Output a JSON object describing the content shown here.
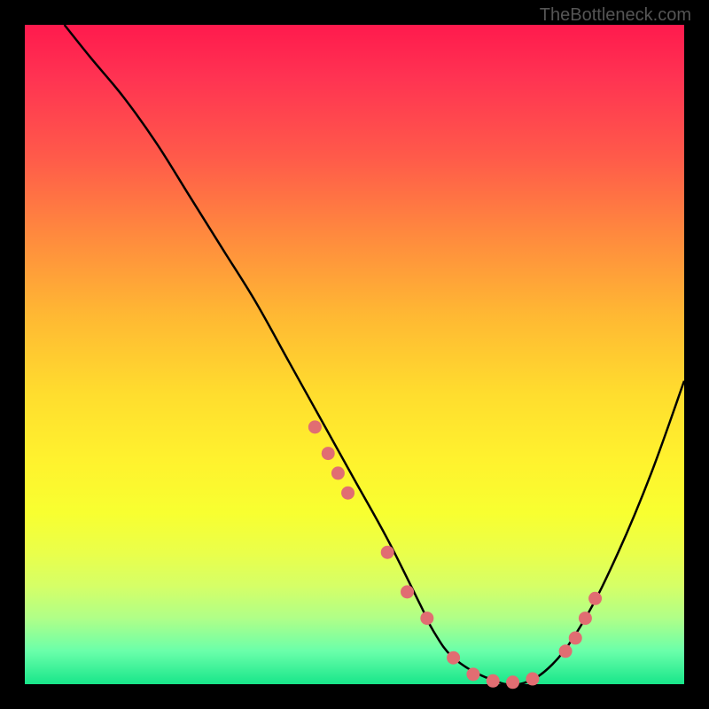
{
  "watermark": "TheBottleneck.com",
  "chart_data": {
    "type": "line",
    "title": "",
    "xlabel": "",
    "ylabel": "",
    "xlim": [
      0,
      100
    ],
    "ylim": [
      0,
      100
    ],
    "x": [
      6,
      10,
      15,
      20,
      25,
      30,
      35,
      40,
      45,
      50,
      55,
      60,
      62,
      65,
      70,
      75,
      80,
      85,
      90,
      95,
      100
    ],
    "values": [
      100,
      95,
      89,
      82,
      74,
      66,
      58,
      49,
      40,
      31,
      22,
      12,
      8,
      4,
      1,
      0,
      3,
      10,
      20,
      32,
      46
    ],
    "markers": {
      "x": [
        44,
        46,
        47.5,
        49,
        55,
        58,
        61,
        65,
        68,
        71,
        74,
        77,
        82,
        83.5,
        85,
        86.5
      ],
      "values": [
        39,
        35,
        32,
        29,
        20,
        14,
        10,
        4,
        1.5,
        0.5,
        0.3,
        0.8,
        5,
        7,
        10,
        13
      ]
    },
    "colors": {
      "line": "#000000",
      "marker": "#e16d72",
      "gradient_top": "#ff1a4d",
      "gradient_bottom": "#18e68a"
    }
  }
}
